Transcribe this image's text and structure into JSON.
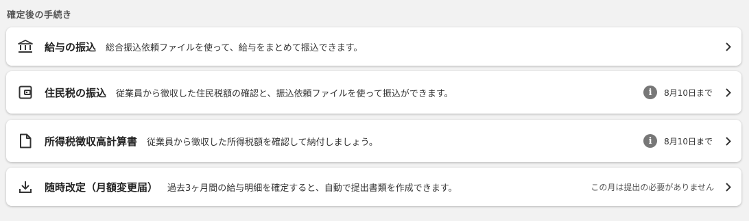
{
  "section_title": "確定後の手続き",
  "items": [
    {
      "icon": "bank-icon",
      "title": "給与の振込",
      "description": "総合振込依頼ファイルを使って、給与をまとめて振込できます。"
    },
    {
      "icon": "wallet-icon",
      "title": "住民税の振込",
      "description": "従業員から徴収した住民税額の確認と、振込依頼ファイルを使って振込ができます。",
      "deadline": "8月10日まで"
    },
    {
      "icon": "document-icon",
      "title": "所得税徴収高計算書",
      "description": "従業員から徴収した所得税額を確認して納付しましょう。",
      "deadline": "8月10日まで"
    },
    {
      "icon": "download-icon",
      "title": "随時改定（月額変更届）",
      "description": "過去3ヶ月間の給与明細を確定すると、自動で提出書類を作成できます。",
      "note": "この月は提出の必要がありません"
    }
  ]
}
